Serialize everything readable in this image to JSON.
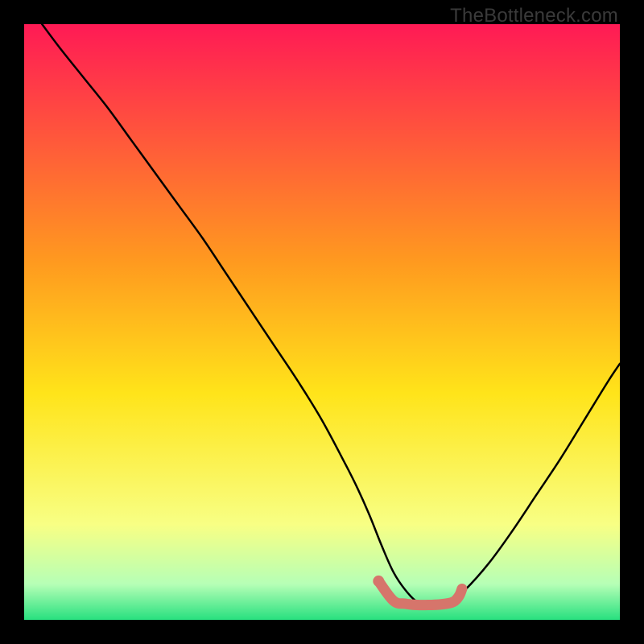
{
  "watermark": "TheBottleneck.com",
  "colors": {
    "gradient_top": "#ff1a55",
    "gradient_mid1": "#ff9a1f",
    "gradient_mid2": "#ffe41a",
    "gradient_mid3": "#f8ff84",
    "gradient_bottom1": "#b6ffb6",
    "gradient_bottom2": "#28e07f",
    "curve": "#000000",
    "marker": "#d6756b"
  },
  "chart_data": {
    "type": "line",
    "title": "",
    "xlabel": "",
    "ylabel": "",
    "xlim": [
      0,
      100
    ],
    "ylim": [
      0,
      100
    ],
    "annotations": [
      "TheBottleneck.com"
    ],
    "series": [
      {
        "name": "bottleneck-curve",
        "x": [
          3,
          6,
          10,
          14,
          18,
          22,
          26,
          30,
          34,
          38,
          42,
          46,
          50,
          54,
          56,
          58,
          60,
          62,
          64,
          66,
          68,
          70,
          72,
          74,
          78,
          82,
          86,
          90,
          94,
          98,
          100
        ],
        "y": [
          100,
          96,
          91,
          86,
          80.5,
          75,
          69.5,
          64,
          58,
          52,
          46,
          40,
          33.5,
          26,
          22,
          17.5,
          12.5,
          8,
          5,
          3,
          2.5,
          2.5,
          3.5,
          5,
          9.5,
          15,
          21,
          27,
          33.5,
          40,
          43
        ]
      },
      {
        "name": "optimal-segment-markers",
        "x": [
          59.5,
          62,
          64,
          66,
          68,
          70,
          72,
          73,
          73.5
        ],
        "y": [
          6.5,
          3.2,
          2.7,
          2.5,
          2.5,
          2.6,
          3.0,
          4.0,
          5.2
        ]
      }
    ]
  }
}
